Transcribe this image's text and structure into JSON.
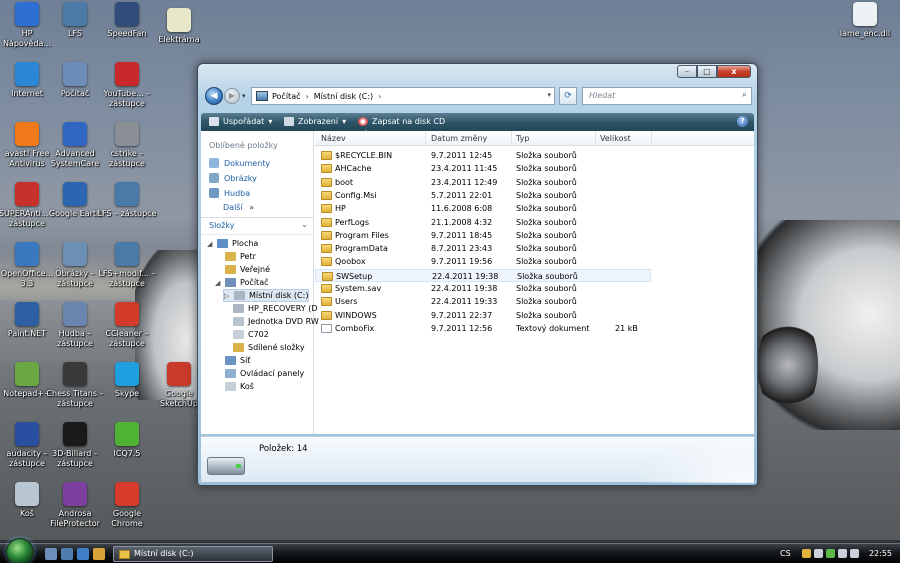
{
  "desktop": {
    "icons": [
      {
        "label": "HP Nápověda...",
        "name": "hp-help",
        "color": "#2d6fd3"
      },
      {
        "label": "LFS",
        "name": "lfs",
        "color": "#4a7aa8"
      },
      {
        "label": "SpeedFan",
        "name": "speedfan",
        "color": "#2f4c7a"
      },
      {
        "label": "Elektrárna",
        "name": "elektrarna",
        "color": "#e8e8c8"
      },
      {
        "label": "Internet",
        "name": "internet",
        "color": "#2c86d6"
      },
      {
        "label": "Počítač",
        "name": "pocitac",
        "color": "#6d8cb8"
      },
      {
        "label": "YouTube... – zástupce",
        "name": "youtube",
        "color": "#c8272b"
      },
      {
        "label": "avast! Free Antivirus",
        "name": "avast",
        "color": "#f07a1a"
      },
      {
        "label": "Advanced SystemCare",
        "name": "advanced-systemcare",
        "color": "#2f67c2"
      },
      {
        "label": "cstrike – zástupce",
        "name": "cstrike",
        "color": "#8a8f96"
      },
      {
        "label": "SUPERAnti... – zástupce",
        "name": "superantispyware",
        "color": "#c8312b"
      },
      {
        "label": "Google Earth",
        "name": "google-earth",
        "color": "#2c66b0"
      },
      {
        "label": "LFS – zástupce",
        "name": "lfs-shortcut",
        "color": "#4a7aa8"
      },
      {
        "label": "OpenOffice... 3.3",
        "name": "openoffice",
        "color": "#3a79c0"
      },
      {
        "label": "Obrázky – zástupce",
        "name": "obrazky",
        "color": "#6b8fb5"
      },
      {
        "label": "LFS+modif... – zástupce",
        "name": "lfs-modif",
        "color": "#4a7aa8"
      },
      {
        "label": "Paint.NET",
        "name": "paint-net",
        "color": "#2e5fa3"
      },
      {
        "label": "Hudba – zástupce",
        "name": "hudba",
        "color": "#6a86b0"
      },
      {
        "label": "CCleaner – zástupce",
        "name": "ccleaner",
        "color": "#d23a2a"
      },
      {
        "label": "Notepad++",
        "name": "notepad-plus",
        "color": "#6aa843"
      },
      {
        "label": "Chess Titans – zástupce",
        "name": "chess-titans",
        "color": "#3a3a3a"
      },
      {
        "label": "Skype",
        "name": "skype",
        "color": "#1f9ee0"
      },
      {
        "label": "Google SketchUp",
        "name": "sketchup",
        "color": "#c83a2a"
      },
      {
        "label": "audacity – zástupce",
        "name": "audacity",
        "color": "#2b4fa0"
      },
      {
        "label": "3D-Billard – zástupce",
        "name": "3d-billard",
        "color": "#1a1a1a"
      },
      {
        "label": "ICQ7.5",
        "name": "icq",
        "color": "#4fb233"
      },
      {
        "label": "Koš",
        "name": "kos",
        "color": "#b8c6d2"
      },
      {
        "label": "Androsa FileProtector",
        "name": "androsa",
        "color": "#7d3fa0"
      },
      {
        "label": "Google Chrome",
        "name": "chrome",
        "color": "#d83b2b"
      },
      {
        "label": "lame_enc.dll",
        "name": "lame-enc",
        "color": "#eef1f4"
      }
    ]
  },
  "window": {
    "title": "Místní disk (C:)",
    "caption": {
      "minimize": "–",
      "maximize": "□",
      "close": "x"
    },
    "nav": {
      "back": "◀",
      "forward": "▶",
      "dropdown": "▾"
    },
    "address": {
      "root": "Počítač",
      "current": "Místní disk (C:)",
      "sep": "›",
      "dropdown": "▾"
    },
    "refresh": "⟳",
    "search": {
      "placeholder": "Hledat",
      "icon": "⌕"
    },
    "toolbar": {
      "organize": "Uspořádat",
      "views": "Zobrazení",
      "burn": "Zapsat na disk CD",
      "dropdown": "▾",
      "help": "?"
    },
    "left_pane": {
      "favorites_title": "Oblíbené položky",
      "favorites": [
        "Dokumenty",
        "Obrázky",
        "Hudba"
      ],
      "more": "Další",
      "more_arrow": "»",
      "folders_title": "Složky",
      "folders_chevron": "⌄",
      "tree": [
        {
          "label": "Plocha",
          "level": 0,
          "expand": "◢"
        },
        {
          "label": "Petr",
          "level": 1,
          "expand": ""
        },
        {
          "label": "Veřejné",
          "level": 1,
          "expand": ""
        },
        {
          "label": "Počítač",
          "level": 1,
          "expand": "◢"
        },
        {
          "label": "Místní disk (C:)",
          "level": 2,
          "expand": "▷",
          "selected": true
        },
        {
          "label": "HP_RECOVERY (D",
          "level": 2,
          "expand": ""
        },
        {
          "label": "Jednotka DVD RW",
          "level": 2,
          "expand": ""
        },
        {
          "label": "C702",
          "level": 2,
          "expand": ""
        },
        {
          "label": "Sdílené složky",
          "level": 2,
          "expand": ""
        },
        {
          "label": "Síť",
          "level": 1,
          "expand": ""
        },
        {
          "label": "Ovládací panely",
          "level": 1,
          "expand": ""
        },
        {
          "label": "Koš",
          "level": 1,
          "expand": ""
        }
      ]
    },
    "columns": {
      "name": "Název",
      "date": "Datum změny",
      "type": "Typ",
      "size": "Velikost",
      "sort_indicator": "^"
    },
    "files": [
      {
        "name": "$RECYCLE.BIN",
        "date": "9.7.2011 12:45",
        "type": "Složka souborů",
        "size": "",
        "kind": "folder"
      },
      {
        "name": "AHCache",
        "date": "23.4.2011 11:45",
        "type": "Složka souborů",
        "size": "",
        "kind": "folder"
      },
      {
        "name": "boot",
        "date": "23.4.2011 12:49",
        "type": "Složka souborů",
        "size": "",
        "kind": "folder"
      },
      {
        "name": "Config.Msi",
        "date": "5.7.2011 22:01",
        "type": "Složka souborů",
        "size": "",
        "kind": "folder"
      },
      {
        "name": "HP",
        "date": "11.6.2008 6:08",
        "type": "Složka souborů",
        "size": "",
        "kind": "folder"
      },
      {
        "name": "PerfLogs",
        "date": "21.1.2008 4:32",
        "type": "Složka souborů",
        "size": "",
        "kind": "folder"
      },
      {
        "name": "Program Files",
        "date": "9.7.2011 18:45",
        "type": "Složka souborů",
        "size": "",
        "kind": "folder"
      },
      {
        "name": "ProgramData",
        "date": "8.7.2011 23:43",
        "type": "Složka souborů",
        "size": "",
        "kind": "folder"
      },
      {
        "name": "Qoobox",
        "date": "9.7.2011 19:56",
        "type": "Složka souborů",
        "size": "",
        "kind": "folder"
      },
      {
        "name": "SWSetup",
        "date": "22.4.2011 19:38",
        "type": "Složka souborů",
        "size": "",
        "kind": "folder",
        "highlight": true
      },
      {
        "name": "System.sav",
        "date": "22.4.2011 19:38",
        "type": "Složka souborů",
        "size": "",
        "kind": "folder"
      },
      {
        "name": "Users",
        "date": "22.4.2011 19:33",
        "type": "Složka souborů",
        "size": "",
        "kind": "folder"
      },
      {
        "name": "WINDOWS",
        "date": "9.7.2011 22:37",
        "type": "Složka souborů",
        "size": "",
        "kind": "folder"
      },
      {
        "name": "ComboFix",
        "date": "9.7.2011 12:56",
        "type": "Textový dokument",
        "size": "21 kB",
        "kind": "doc"
      }
    ],
    "details": {
      "count_label": "Položek: 14"
    }
  },
  "taskbar": {
    "active_task": "Místní disk (C:)",
    "language": "CS",
    "clock": "22:55"
  }
}
